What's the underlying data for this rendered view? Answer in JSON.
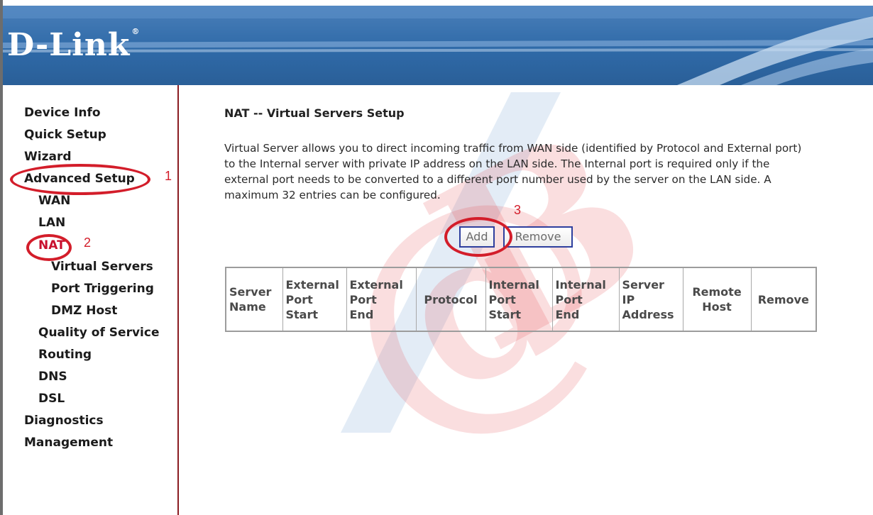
{
  "header": {
    "logo": "D-Link",
    "logo_mark": "®"
  },
  "sidebar": {
    "items": [
      {
        "label": "Device Info"
      },
      {
        "label": "Quick Setup"
      },
      {
        "label": "Wizard"
      },
      {
        "label": "Advanced Setup"
      },
      {
        "label": "WAN"
      },
      {
        "label": "LAN"
      },
      {
        "label": "NAT"
      },
      {
        "label": "Virtual Servers"
      },
      {
        "label": "Port Triggering"
      },
      {
        "label": "DMZ Host"
      },
      {
        "label": "Quality of Service"
      },
      {
        "label": "Routing"
      },
      {
        "label": "DNS"
      },
      {
        "label": "DSL"
      },
      {
        "label": "Diagnostics"
      },
      {
        "label": "Management"
      }
    ]
  },
  "annotations": {
    "n1": "1",
    "n2": "2",
    "n3": "3"
  },
  "main": {
    "title": "NAT -- Virtual Servers Setup",
    "description": "Virtual Server allows you to direct incoming traffic from WAN side (identified by Protocol and External port) to the Internal server with private IP address on the LAN side. The Internal port is required only if the external port needs to be converted to a different port number used by the server on the LAN side. A maximum 32 entries can be configured.",
    "add_label": "Add",
    "remove_label": "Remove",
    "table": {
      "columns": [
        {
          "l1": "Server",
          "l2": "Name",
          "l3": ""
        },
        {
          "l1": "External",
          "l2": "Port",
          "l3": "Start"
        },
        {
          "l1": "External",
          "l2": "Port",
          "l3": "End"
        },
        {
          "l1": "Protocol",
          "l2": "",
          "l3": ""
        },
        {
          "l1": "Internal",
          "l2": "Port",
          "l3": "Start"
        },
        {
          "l1": "Internal",
          "l2": "Port",
          "l3": "End"
        },
        {
          "l1": "Server",
          "l2": "IP",
          "l3": "Address"
        },
        {
          "l1": "Remote",
          "l2": "Host",
          "l3": ""
        },
        {
          "l1": "Remove",
          "l2": "",
          "l3": ""
        }
      ]
    }
  },
  "colors": {
    "banner": "#2f6aa8",
    "annotation": "#d31d2a",
    "active_nav": "#c8102e"
  }
}
